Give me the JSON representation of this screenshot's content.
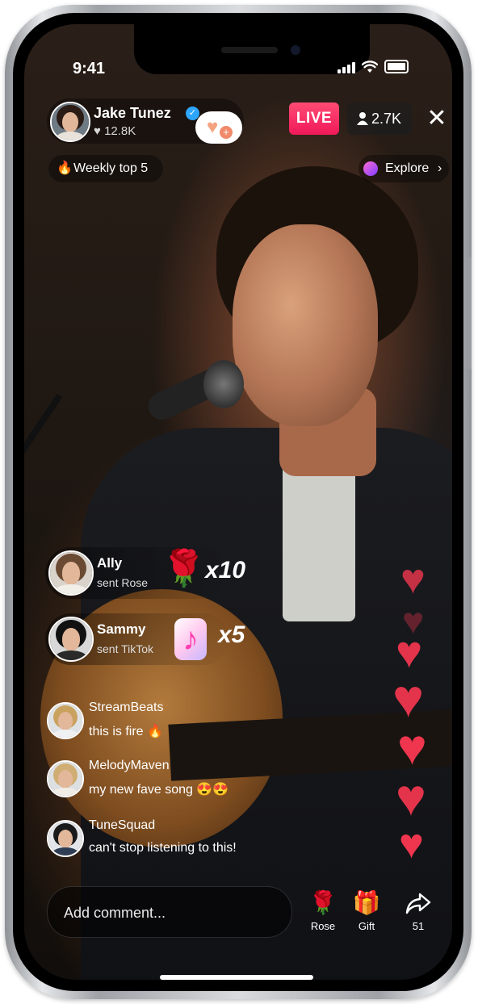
{
  "status_bar": {
    "time": "9:41"
  },
  "host": {
    "name": "Jake Tunez",
    "likes": "12.8K"
  },
  "live_badge": "LIVE",
  "viewers": "2.7K",
  "pills": {
    "weekly": "Weekly top 5",
    "explore": "Explore"
  },
  "gifts": [
    {
      "name": "Ally",
      "action": "sent Rose",
      "count": "x10"
    },
    {
      "name": "Sammy",
      "action": "sent TikTok",
      "count": "x5"
    }
  ],
  "comments": [
    {
      "user": "StreamBeats",
      "text": "this is fire 🔥"
    },
    {
      "user": "MelodyMaven",
      "text": "my new fave song 😍😍"
    },
    {
      "user": "TuneSquad",
      "text": "can't stop listening to this!"
    }
  ],
  "composer": {
    "placeholder": "Add comment..."
  },
  "actions": [
    {
      "label": "Rose",
      "icon": "rose-icon"
    },
    {
      "label": "Gift",
      "icon": "gift-icon"
    },
    {
      "label": "51",
      "icon": "share-icon"
    }
  ],
  "colors": {
    "live": "#f0195a",
    "verified": "#2ea6ff",
    "heart": "#f0364e"
  }
}
